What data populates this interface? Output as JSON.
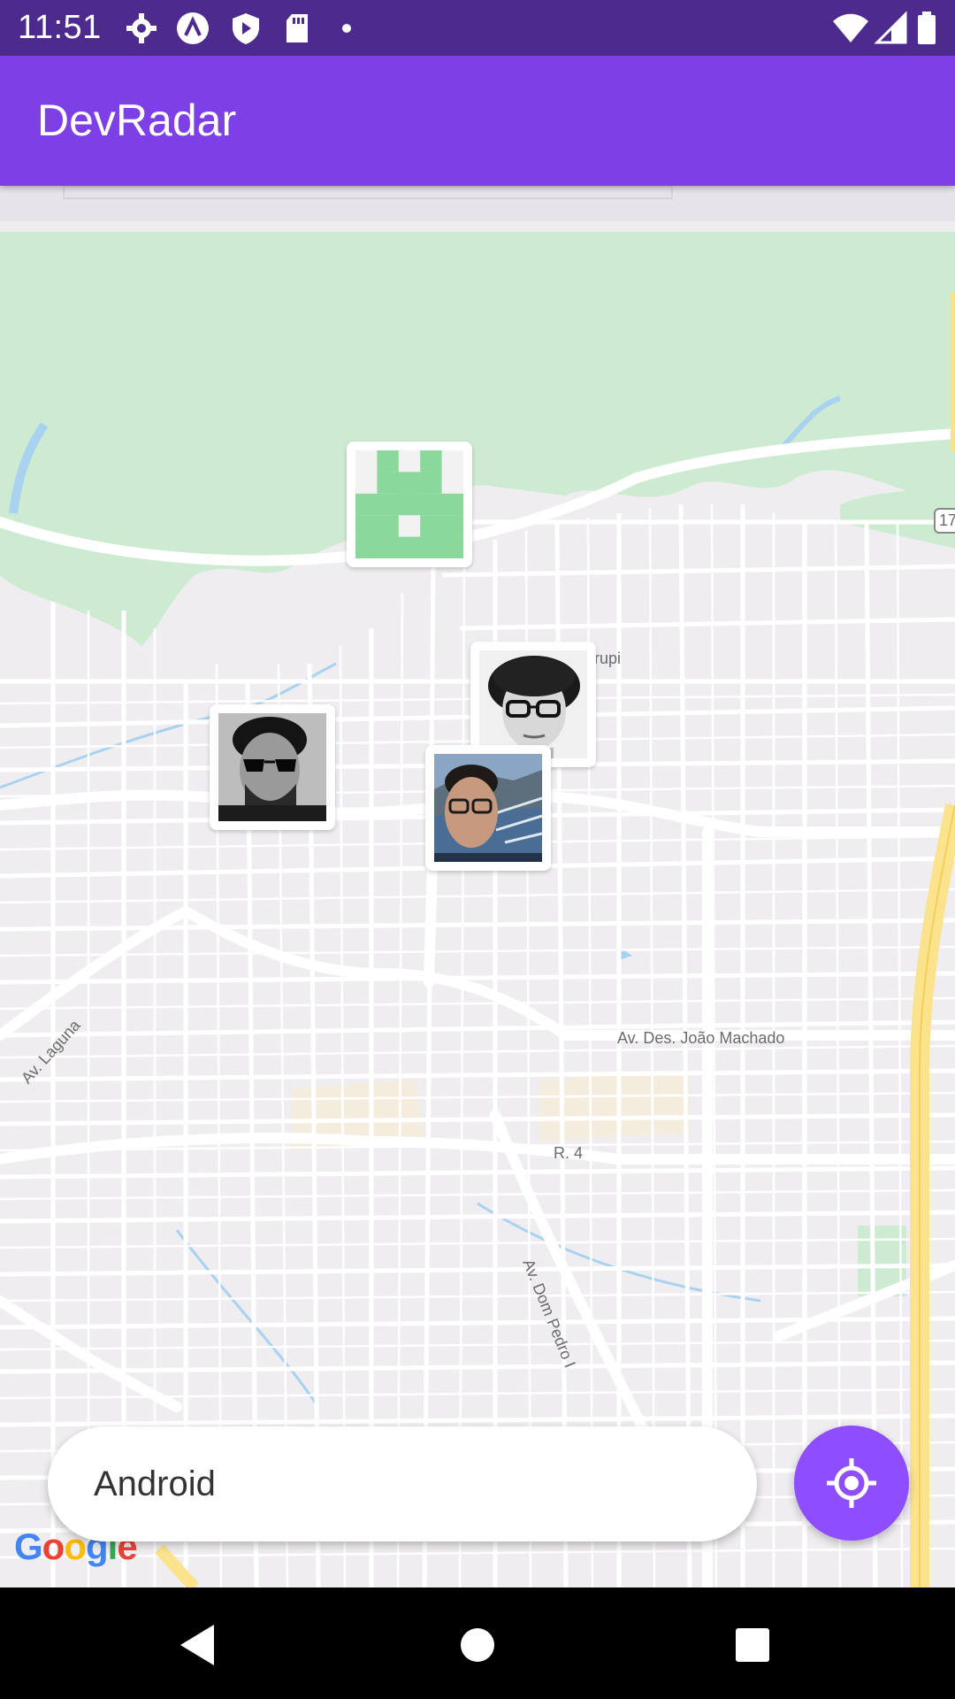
{
  "status_bar": {
    "time": "11:51",
    "left_icons": [
      "settings-icon",
      "app-a-icon",
      "shield-icon",
      "sd-card-icon",
      "dot-icon"
    ],
    "right_icons": [
      "wifi-icon",
      "signal-icon",
      "battery-icon"
    ]
  },
  "app_bar": {
    "title": "DevRadar"
  },
  "map": {
    "labels": [
      "urupi",
      "Av. Laguna",
      "Av. Des. João Machado",
      "R. 4",
      "Av. Dom Pedro I",
      "17"
    ],
    "markers": [
      "identicon-avatar",
      "dev-avatar-glasses-curly",
      "dev-avatar-sunglasses",
      "dev-avatar-selfie"
    ],
    "attribution": "Google"
  },
  "search": {
    "value": "Android"
  },
  "colors": {
    "status_bar": "#4c2a8e",
    "app_bar": "#7d40e7",
    "locate_button": "#8e4dff",
    "map_land": "#efedf0",
    "park": "#cdebd0",
    "highway": "#fbe28c"
  },
  "nav_bar": {
    "buttons": [
      "back-icon",
      "home-icon",
      "recents-icon"
    ]
  }
}
